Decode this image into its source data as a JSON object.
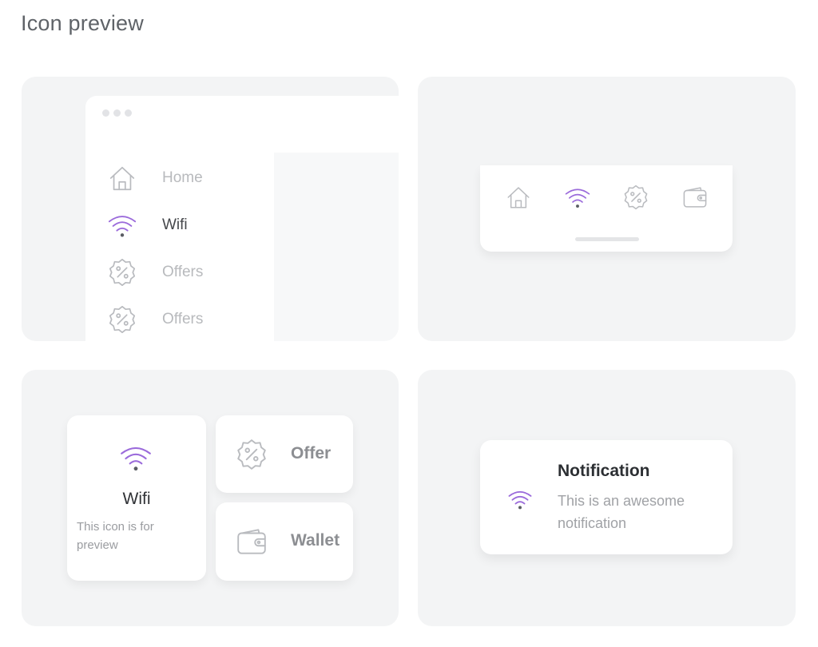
{
  "page": {
    "title": "Icon preview"
  },
  "colors": {
    "accent": "#9b6bdb",
    "icon_muted": "#b9bbbf",
    "panel_bg": "#f3f4f5",
    "card_bg": "#ffffff"
  },
  "sidebar_preview": {
    "items": [
      {
        "icon": "home-icon",
        "label": "Home",
        "active": false
      },
      {
        "icon": "wifi-icon",
        "label": "Wifi",
        "active": true
      },
      {
        "icon": "offer-icon",
        "label": "Offers",
        "active": false
      },
      {
        "icon": "offer-icon",
        "label": "Offers",
        "active": false
      }
    ]
  },
  "tabbar_preview": {
    "tabs": [
      {
        "icon": "home-icon",
        "active": false
      },
      {
        "icon": "wifi-icon",
        "active": true
      },
      {
        "icon": "offer-icon",
        "active": false
      },
      {
        "icon": "wallet-icon",
        "active": false
      }
    ]
  },
  "cards_preview": {
    "wifi_card": {
      "icon": "wifi-icon",
      "title": "Wifi",
      "description": "This icon is for preview"
    },
    "offer_card": {
      "icon": "offer-icon",
      "label": "Offer"
    },
    "wallet_card": {
      "icon": "wallet-icon",
      "label": "Wallet"
    }
  },
  "notification_preview": {
    "icon": "wifi-icon",
    "title": "Notification",
    "body": "This is an awesome notification"
  }
}
